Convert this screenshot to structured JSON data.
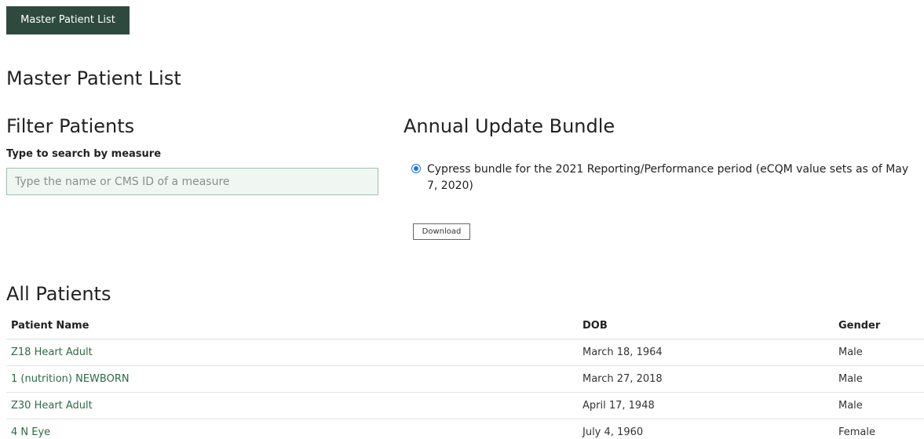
{
  "nav": {
    "master_patient_list_label": "Master Patient List"
  },
  "page": {
    "title": "Master Patient List"
  },
  "filter": {
    "title": "Filter Patients",
    "search_label": "Type to search by measure",
    "search_placeholder": "Type the name or CMS ID of a measure",
    "search_value": ""
  },
  "bundle": {
    "title": "Annual Update Bundle",
    "option_label": "Cypress bundle for the 2021 Reporting/Performance period (eCQM value sets as of May 7, 2020)",
    "option_selected": true,
    "download_label": "Download"
  },
  "patients": {
    "title": "All Patients",
    "columns": {
      "name": "Patient Name",
      "dob": "DOB",
      "gender": "Gender"
    },
    "rows": [
      {
        "name": "Z18 Heart Adult",
        "dob": "March 18, 1964",
        "gender": "Male"
      },
      {
        "name": "1 (nutrition) NEWBORN",
        "dob": "March 27, 2018",
        "gender": "Male"
      },
      {
        "name": "Z30 Heart Adult",
        "dob": "April 17, 1948",
        "gender": "Male"
      },
      {
        "name": "4 N Eye",
        "dob": "July 4, 1960",
        "gender": "Female"
      }
    ]
  },
  "colors": {
    "primary": "#2e4a3f",
    "link": "#2e6a47",
    "radio": "#1a73e8"
  }
}
